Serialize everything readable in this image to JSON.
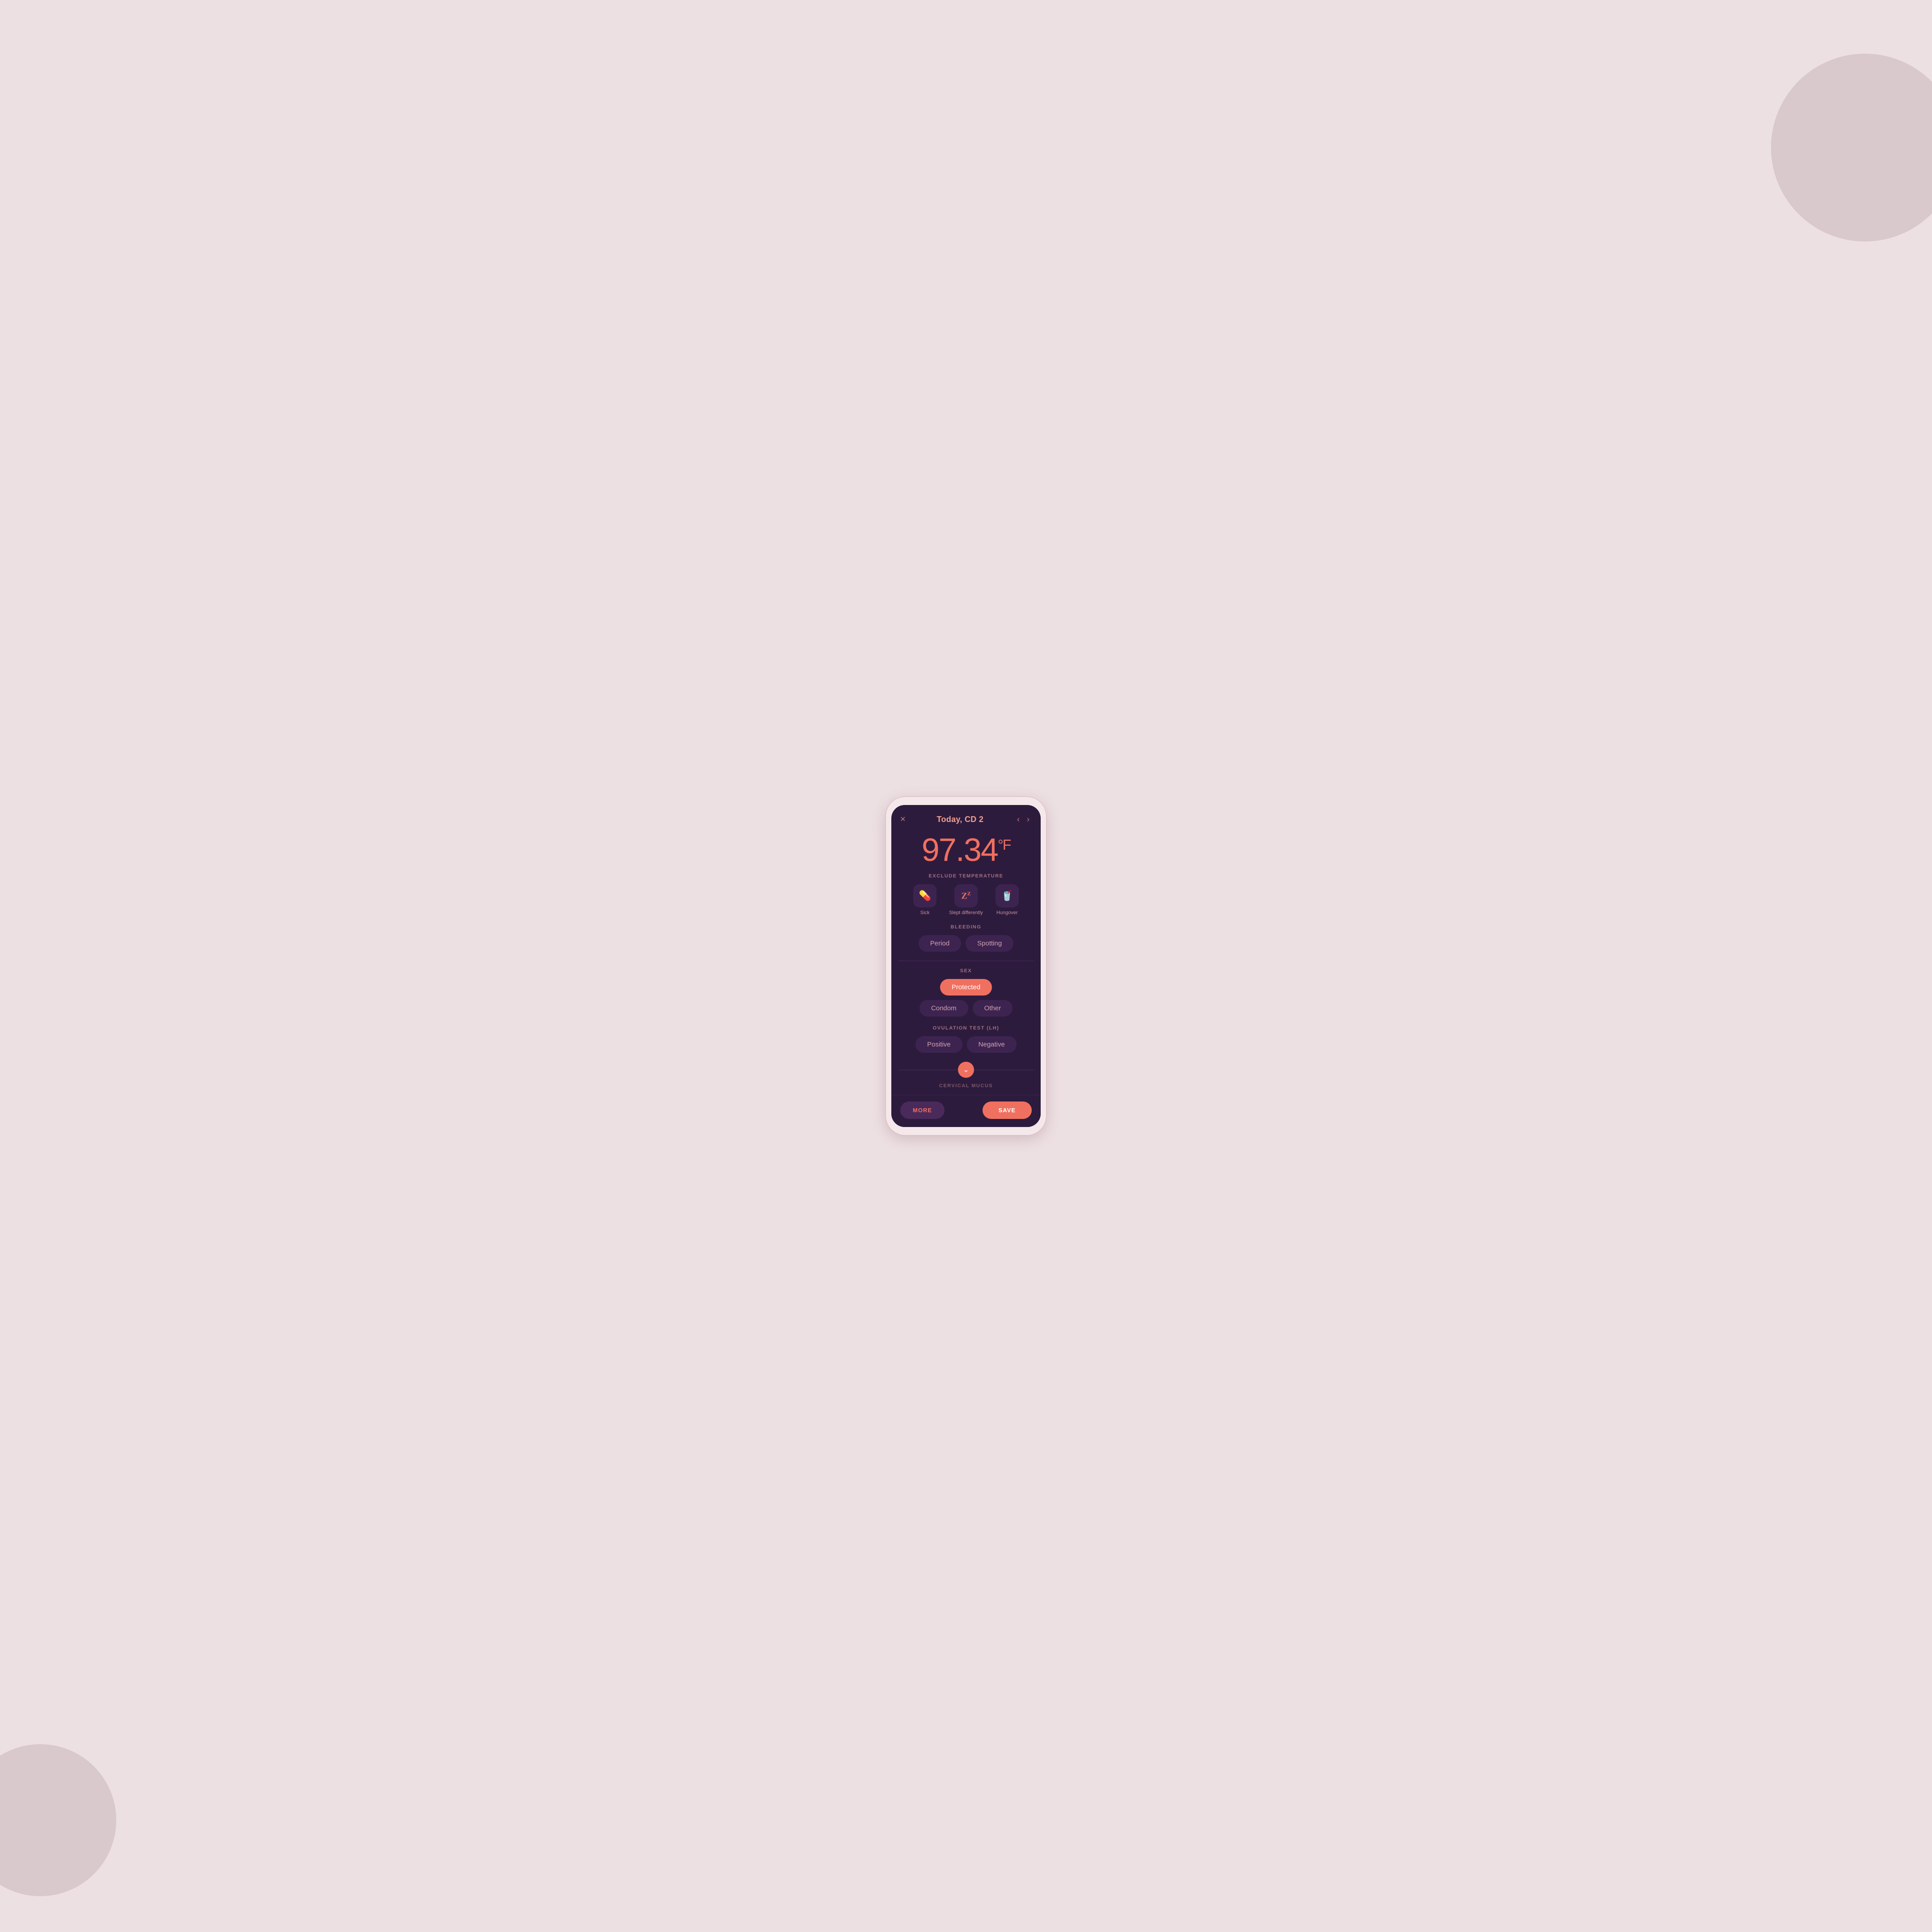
{
  "background": {
    "color": "#ede0e3"
  },
  "header": {
    "title": "Today, CD 2",
    "close_label": "×",
    "nav_back": "‹",
    "nav_forward": "›"
  },
  "temperature": {
    "value": "97.34",
    "unit": "°F"
  },
  "exclude_temperature": {
    "label": "EXCLUDE TEMPERATURE",
    "options": [
      {
        "id": "sick",
        "icon": "💊",
        "label": "Sick"
      },
      {
        "id": "slept-differently",
        "icon": "💤",
        "label": "Slept differently"
      },
      {
        "id": "hungover",
        "icon": "🥤",
        "label": "Hungover"
      }
    ]
  },
  "bleeding": {
    "label": "BLEEDING",
    "options": [
      {
        "id": "period",
        "label": "Period",
        "active": false
      },
      {
        "id": "spotting",
        "label": "Spotting",
        "active": false
      }
    ]
  },
  "sex": {
    "label": "SEX",
    "options": [
      {
        "id": "protected",
        "label": "Protected",
        "active": true
      },
      {
        "id": "condom",
        "label": "Condom",
        "active": false
      },
      {
        "id": "other",
        "label": "Other",
        "active": false
      }
    ]
  },
  "ovulation_test": {
    "label": "OVULATION TEST (LH)",
    "options": [
      {
        "id": "positive",
        "label": "Positive",
        "active": false
      },
      {
        "id": "negative",
        "label": "Negative",
        "active": false
      }
    ]
  },
  "cervical_mucus": {
    "label": "CERVICAL MUCUS"
  },
  "footer": {
    "more_label": "MORE",
    "save_label": "SAVE"
  }
}
